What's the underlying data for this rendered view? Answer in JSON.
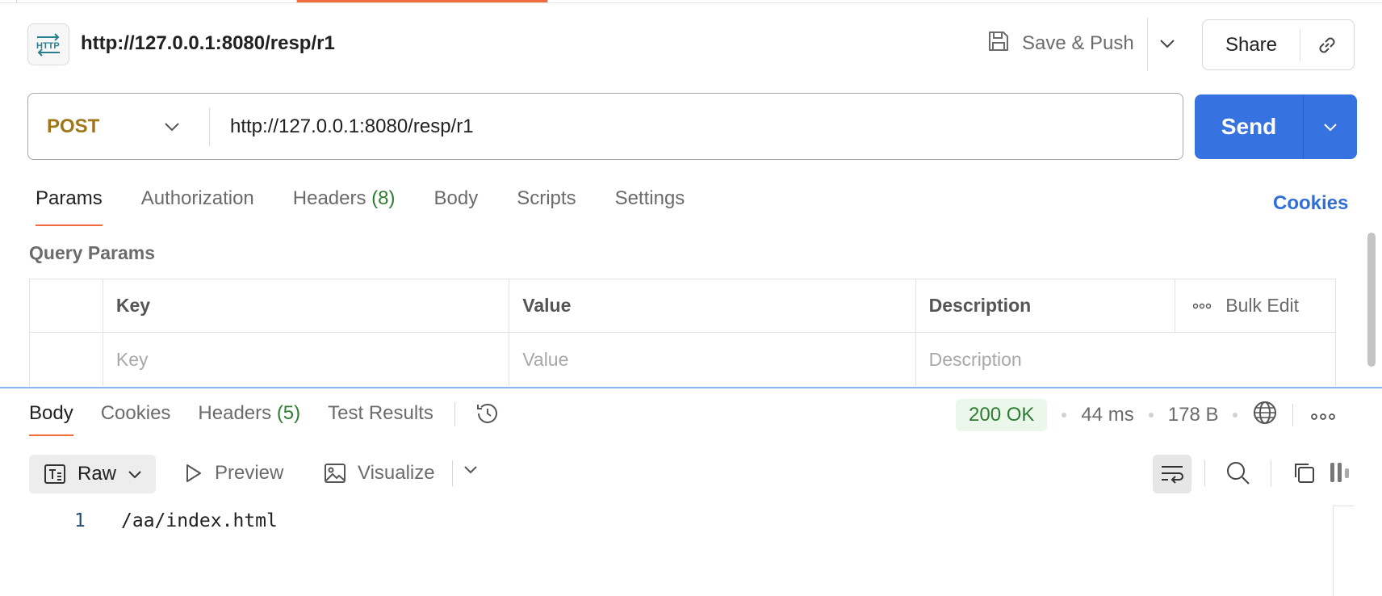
{
  "header": {
    "badge_icon": "http-icon",
    "title": "http://127.0.0.1:8080/resp/r1",
    "save_push_label": "Save & Push",
    "share_label": "Share"
  },
  "request": {
    "method": "POST",
    "method_color": "#a0761b",
    "url": "http://127.0.0.1:8080/resp/r1",
    "send_label": "Send",
    "send_color": "#3672e0"
  },
  "request_tabs": [
    {
      "label": "Params",
      "count": "",
      "active": true
    },
    {
      "label": "Authorization",
      "count": "",
      "active": false
    },
    {
      "label": "Headers",
      "count": "(8)",
      "active": false
    },
    {
      "label": "Body",
      "count": "",
      "active": false
    },
    {
      "label": "Scripts",
      "count": "",
      "active": false
    },
    {
      "label": "Settings",
      "count": "",
      "active": false
    }
  ],
  "cookies_link": "Cookies",
  "query_params": {
    "title": "Query Params",
    "columns": [
      "Key",
      "Value",
      "Description"
    ],
    "bulk_edit_label": "Bulk Edit",
    "placeholders": {
      "key": "Key",
      "value": "Value",
      "description": "Description"
    }
  },
  "response_tabs": [
    {
      "label": "Body",
      "count": "",
      "active": true
    },
    {
      "label": "Cookies",
      "count": "",
      "active": false
    },
    {
      "label": "Headers",
      "count": "(5)",
      "active": false
    },
    {
      "label": "Test Results",
      "count": "",
      "active": false
    }
  ],
  "response_status": {
    "status": "200 OK",
    "time": "44 ms",
    "size": "178 B"
  },
  "response_toolbar": {
    "raw_label": "Raw",
    "preview_label": "Preview",
    "visualize_label": "Visualize"
  },
  "response_body": {
    "line_number": "1",
    "line_text": "/aa/index.html"
  },
  "accent_color": "#f26b3a"
}
